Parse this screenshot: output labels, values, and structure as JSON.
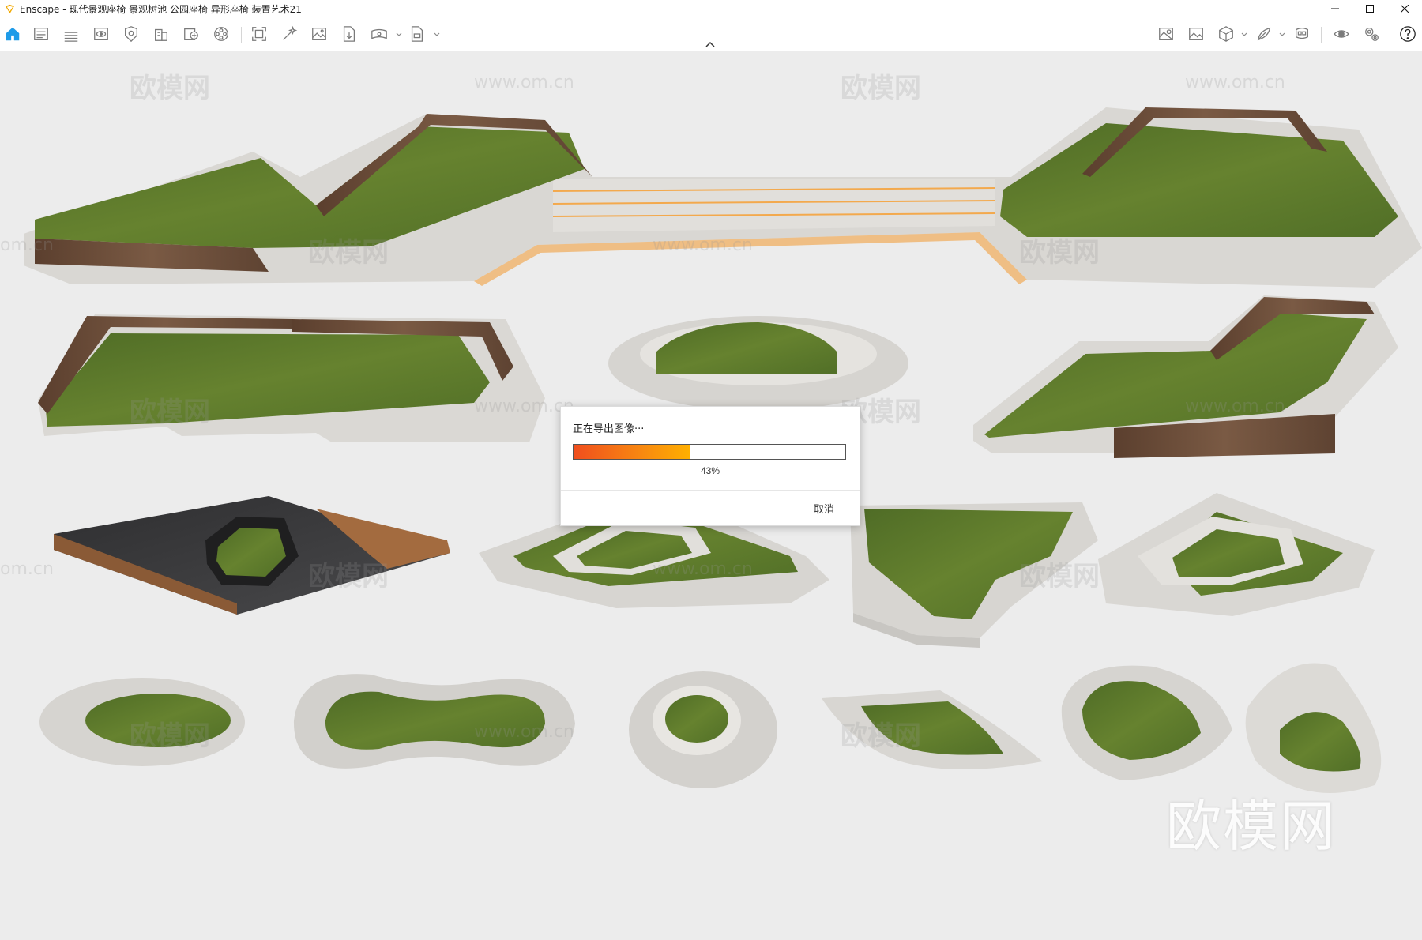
{
  "window": {
    "app_name": "Enscape",
    "title": "Enscape - 现代景观座椅 景观树池 公园座椅 异形座椅 装置艺术21",
    "controls": [
      "minimize-icon",
      "maximize-icon",
      "close-icon"
    ]
  },
  "toolbar": {
    "left_icons": [
      "home-icon",
      "document-icon",
      "bim-icon",
      "view-icon",
      "asset-icon",
      "building-icon",
      "add-asset-icon",
      "video-icon",
      "screenshot-icon",
      "batch-render-icon",
      "image-icon",
      "file-export-icon",
      "panorama-icon",
      "export-icon"
    ],
    "right_icons": [
      "atmosphere-icon",
      "image-settings-icon",
      "cube-icon",
      "material-icon",
      "vr-headset-icon",
      "visibility-icon",
      "settings-icon",
      "help-icon"
    ]
  },
  "watermarks": {
    "brand_cn": "欧模网",
    "url": "www.om.cn",
    "url_clipped": "om.cn",
    "large_brand": "欧模网"
  },
  "export_dialog": {
    "title": "正在导出图像···",
    "progress_percent": 43,
    "progress_label": "43%",
    "cancel_label": "取消",
    "colors": {
      "progress_start": "#f04e1e",
      "progress_end": "#ffb000"
    }
  },
  "scene": {
    "colors": {
      "grass": "#5e7a30",
      "grass_dark": "#4e6a26",
      "concrete": "#dedcd8",
      "wood": "#6a4c38",
      "ground": "#ececec",
      "accent_line": "#f2a040",
      "dark_stone": "#3a3a3c"
    }
  }
}
